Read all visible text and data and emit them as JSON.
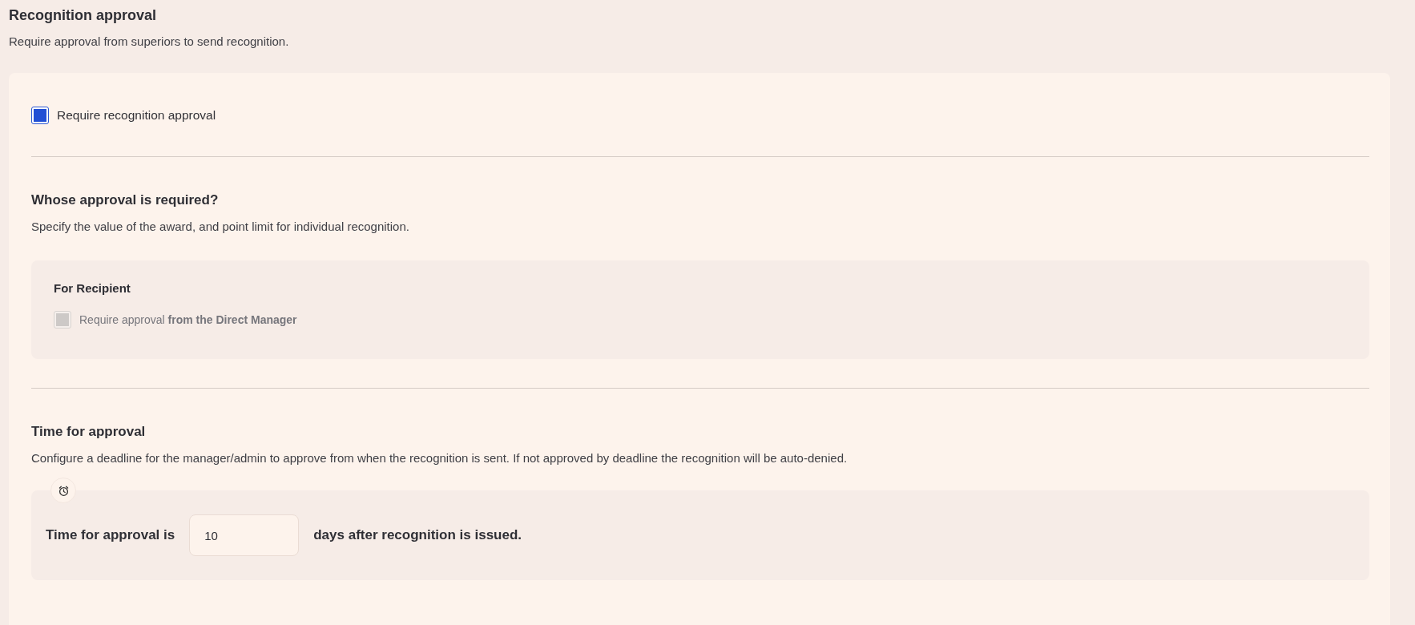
{
  "header": {
    "title": "Recognition approval",
    "description": "Require approval from superiors to send recognition."
  },
  "main_checkbox": {
    "label": "Require recognition approval",
    "checked": true,
    "disabled": false
  },
  "whose_approval": {
    "title": "Whose approval is required?",
    "description": "Specify the value of the award, and point limit for individual recognition.",
    "groups": [
      {
        "title": "For Recipient",
        "options": [
          {
            "label": "Require approval **from the Direct Manager**",
            "checked": false,
            "disabled": true
          }
        ]
      }
    ]
  },
  "time_for_approval": {
    "title": "Time for approval",
    "description": "Configure a deadline for the manager/admin to approve from when the recognition is sent. If not approved by deadline the recognition will be auto-denied.",
    "prefix": "Time for approval is",
    "value": "10",
    "suffix": "days after recognition is issued."
  }
}
